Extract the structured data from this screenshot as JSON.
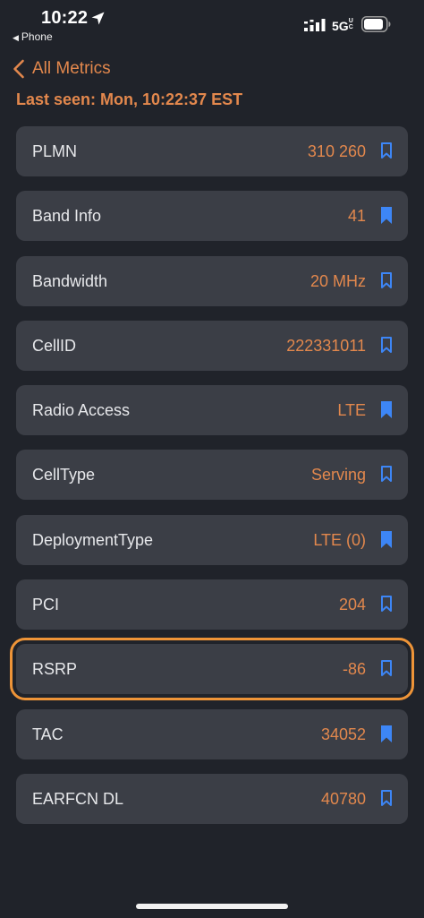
{
  "status_bar": {
    "time": "10:22",
    "back_app": "Phone",
    "network": "5G",
    "network_suffix": "UC"
  },
  "nav": {
    "back_label": "All Metrics"
  },
  "last_seen": "Last seen: Mon, 10:22:37 EST",
  "colors": {
    "accent": "#e3884d",
    "bookmark": "#3d86f6",
    "row_background": "#3b3e46",
    "highlight_outline": "#ee9438"
  },
  "metrics": [
    {
      "label": "PLMN",
      "value": "310 260",
      "bookmarked": false
    },
    {
      "label": "Band Info",
      "value": "41",
      "bookmarked": true
    },
    {
      "label": "Bandwidth",
      "value": "20 MHz",
      "bookmarked": false
    },
    {
      "label": "CellID",
      "value": "222331011",
      "bookmarked": false
    },
    {
      "label": "Radio Access",
      "value": "LTE",
      "bookmarked": true
    },
    {
      "label": "CellType",
      "value": "Serving",
      "bookmarked": false
    },
    {
      "label": "DeploymentType",
      "value": "LTE (0)",
      "bookmarked": true
    },
    {
      "label": "PCI",
      "value": "204",
      "bookmarked": false
    },
    {
      "label": "RSRP",
      "value": "-86",
      "bookmarked": false,
      "highlighted": true
    },
    {
      "label": "TAC",
      "value": "34052",
      "bookmarked": true
    },
    {
      "label": "EARFCN DL",
      "value": "40780",
      "bookmarked": false
    }
  ]
}
